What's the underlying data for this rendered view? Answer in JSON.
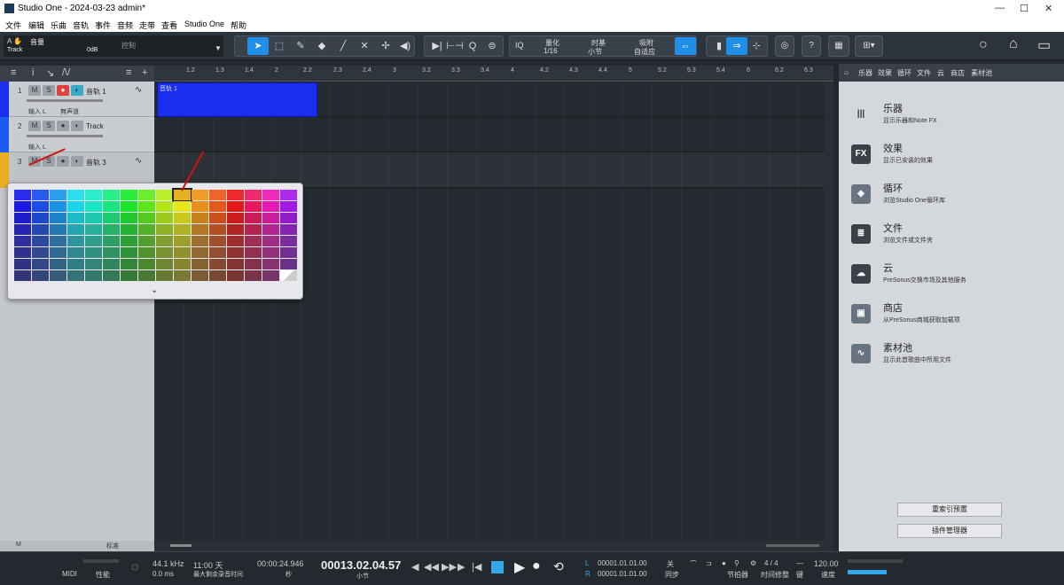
{
  "window": {
    "title": "Studio One - 2024-03-23 admin*",
    "min": "—",
    "max": "☐",
    "close": "✕"
  },
  "menu": [
    "文件",
    "编辑",
    "乐曲",
    "音轨",
    "事件",
    "音频",
    "走带",
    "查看",
    "Studio One",
    "帮助"
  ],
  "toolbar": {
    "channel_name": "音量",
    "channel_sub": "Track",
    "channel_val": "0dB",
    "control": "控制",
    "quantize_label": "量化",
    "quantize_val": "1/16",
    "timebase_label": "时基",
    "timebase_val": "小节",
    "snap_label": "吸附",
    "snap_val": "自适应",
    "iq": "IQ"
  },
  "ruler": [
    "1.2",
    "1.3",
    "1.4",
    "2",
    "2.2",
    "2.3",
    "2.4",
    "3",
    "3.2",
    "3.3",
    "3.4",
    "4",
    "4.2",
    "4.3",
    "4.4",
    "5",
    "5.2",
    "5.3",
    "5.4",
    "6",
    "6.2",
    "6.3"
  ],
  "tracks": [
    {
      "num": "1",
      "name": "音轨 1",
      "input": "输入 L",
      "tag": "無声道",
      "color": "#1b2ef0",
      "record": true
    },
    {
      "num": "2",
      "name": "Track",
      "input": "输入 L",
      "tag": "無声道",
      "color": "#1b5af0",
      "record": false
    },
    {
      "num": "3",
      "name": "音轨 3",
      "input": "输入 L",
      "tag": "無声道",
      "color": "#e8b020",
      "record": false
    }
  ],
  "clip": {
    "label": "音轨 1"
  },
  "left_bottom": {
    "m": "M",
    "mode": "标准"
  },
  "browser": {
    "tabs": [
      "乐器",
      "效果",
      "循环",
      "文件",
      "云",
      "商店",
      "素材池"
    ],
    "items": [
      {
        "title": "乐器",
        "desc": "显示乐器和Note FX",
        "icon": "|||"
      },
      {
        "title": "效果",
        "desc": "显示已安装的效果",
        "icon": "FX"
      },
      {
        "title": "循环",
        "desc": "浏览Studio One循环库",
        "icon": "◈"
      },
      {
        "title": "文件",
        "desc": "浏览文件或文件夹",
        "icon": "≣"
      },
      {
        "title": "云",
        "desc": "PreSonus交换市场及其他服务",
        "icon": "☁"
      },
      {
        "title": "商店",
        "desc": "从PreSonus商城获取加载项",
        "icon": "▣"
      },
      {
        "title": "素材池",
        "desc": "显示此首歌曲中所用文件",
        "icon": "∿"
      }
    ],
    "reindex_btn": "重索引预置",
    "plugin_mgr_btn": "插件管理器"
  },
  "transport": {
    "midi": "MIDI",
    "perf": "性能",
    "sample_rate": "44.1 kHz",
    "latency": "0.0 ms",
    "rec_days": "11:00 天",
    "rec_label": "最大剩余录音时间",
    "time_sec": "00:00:24.946",
    "sec_label": "秒",
    "position": "00013.02.04.57",
    "bars_label": "小节",
    "loop_L": "00001.01.01.00",
    "loop_R": "00001.01.01.00",
    "L": "L",
    "R": "R",
    "sync_label": "关",
    "sync_sub": "同步",
    "metro_label": "节拍器",
    "sig": "4 / 4",
    "sig_label": "时间修整",
    "key_label": "键",
    "tempo": "120.00",
    "tempo_label": "速度"
  },
  "colors": {
    "accent": "#1e8ee8",
    "clip": "#1b2ef0",
    "selected_swatch": "#e8b020"
  }
}
